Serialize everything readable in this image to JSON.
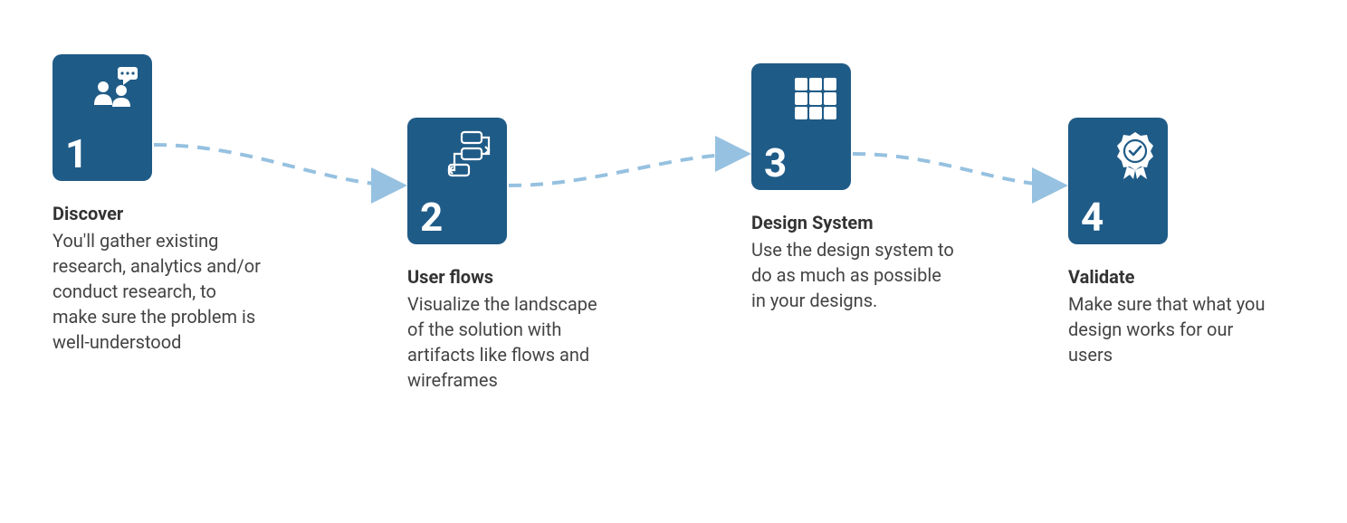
{
  "colors": {
    "card_bg": "#1f5b87",
    "connector": "#96c1e0",
    "text": "#444444",
    "title": "#333333"
  },
  "steps": [
    {
      "num": "1",
      "icon": "people-chat-icon",
      "title": "Discover",
      "body": "You'll gather existing research, analytics and/or conduct research, to make sure the problem is well-understood"
    },
    {
      "num": "2",
      "icon": "flow-boxes-icon",
      "title": "User flows",
      "body": "Visualize the landscape of the solution with artifacts like flows and wireframes"
    },
    {
      "num": "3",
      "icon": "grid-icon",
      "title": "Design System",
      "body": "Use the design system to do as much as possible in your designs."
    },
    {
      "num": "4",
      "icon": "ribbon-check-icon",
      "title": "Validate",
      "body": "Make sure that what you design works for our users"
    }
  ]
}
